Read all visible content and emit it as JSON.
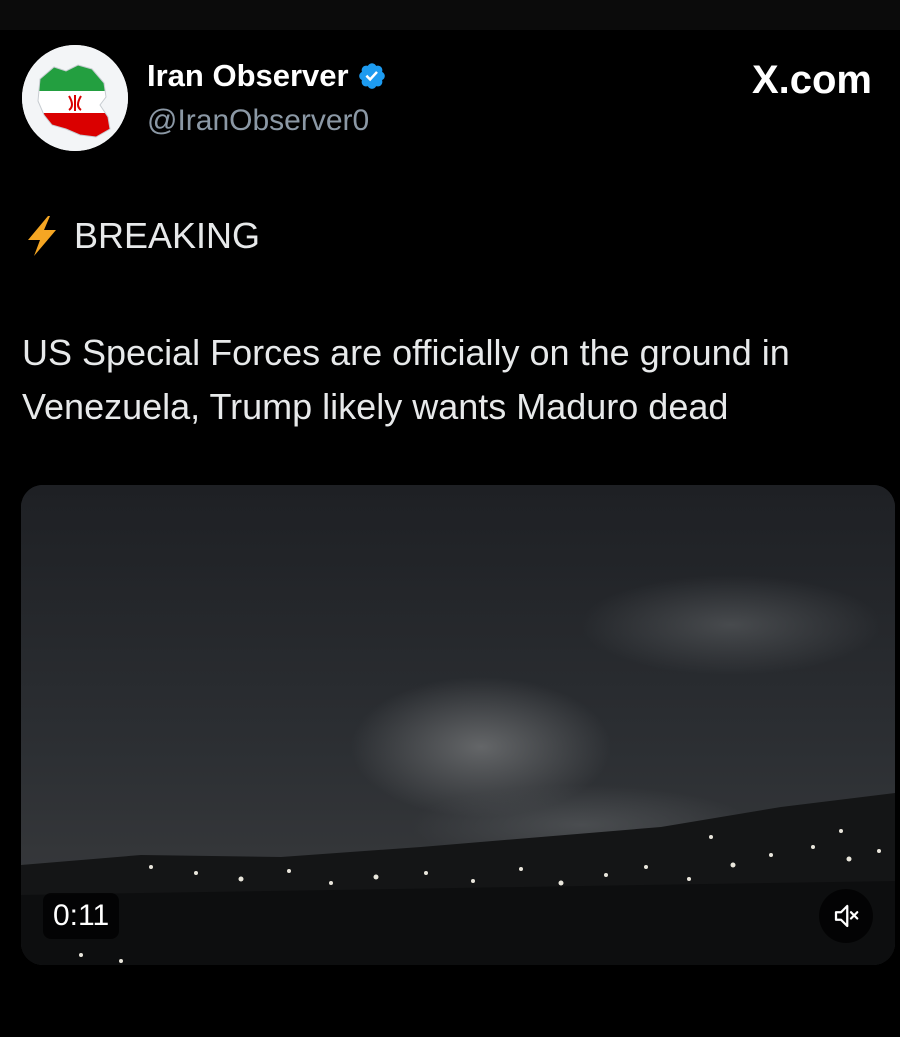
{
  "header": {
    "display_name": "Iran Observer",
    "handle": "@IranObserver0",
    "verified": true,
    "site": "X.com",
    "avatar_icon": "iran-map-flag-icon"
  },
  "tweet": {
    "tag_icon": "lightning-bolt-icon",
    "tag_text": "BREAKING",
    "body": "US Special Forces are officially on the ground in Venezuela, Trump likely wants Maduro dead"
  },
  "video": {
    "duration": "0:11",
    "muted": true,
    "mute_icon": "speaker-muted-icon",
    "description_scene": "night-sky-city-lights"
  },
  "colors": {
    "background": "#000000",
    "text": "#e7e9ea",
    "secondary_text": "#8b98a5",
    "verified_blue": "#1d9bf0",
    "bolt_yellow": "#f5a623"
  }
}
